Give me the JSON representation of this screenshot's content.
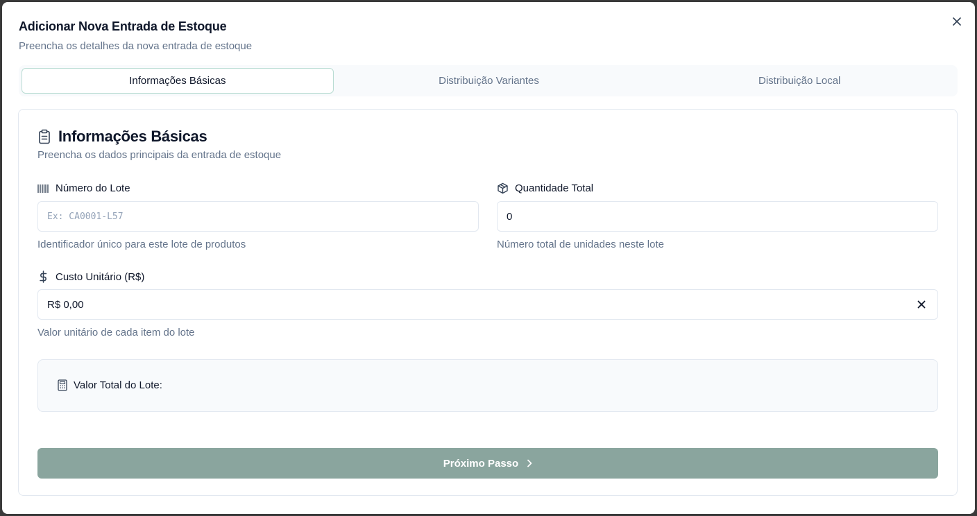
{
  "dialog": {
    "title": "Adicionar Nova Entrada de Estoque",
    "description": "Preencha os detalhes da nova entrada de estoque",
    "close_icon": "close-icon"
  },
  "tabs": [
    {
      "label": "Informações Básicas",
      "active": true
    },
    {
      "label": "Distribuição Variantes",
      "active": false
    },
    {
      "label": "Distribuição Local",
      "active": false
    }
  ],
  "card": {
    "icon": "clipboard-icon",
    "title": "Informações Básicas",
    "description": "Preencha os dados principais da entrada de estoque"
  },
  "fields": {
    "batch_number": {
      "icon": "barcode-icon",
      "label": "Número do Lote",
      "placeholder": "Ex: CA0001-L57",
      "value": "",
      "helper": "Identificador único para este lote de produtos"
    },
    "total_quantity": {
      "icon": "package-icon",
      "label": "Quantidade Total",
      "value": "0",
      "helper": "Número total de unidades neste lote"
    },
    "unit_cost": {
      "icon": "dollar-icon",
      "label": "Custo Unitário (R$)",
      "value": "R$ 0,00",
      "helper": "Valor unitário de cada item do lote"
    }
  },
  "total": {
    "icon": "calculator-icon",
    "label": "Valor Total do Lote:"
  },
  "next_button": {
    "label": "Próximo Passo",
    "icon": "chevron-right-icon"
  },
  "colors": {
    "accent": "#8aa59e",
    "active_tab_border": "#b9dcd3",
    "muted_text": "#64748b"
  }
}
